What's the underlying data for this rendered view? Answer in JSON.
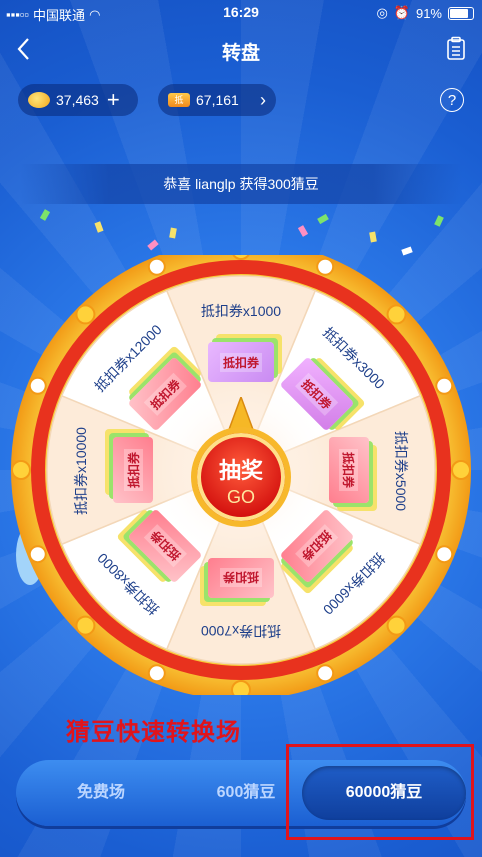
{
  "status_bar": {
    "carrier": "中国联通",
    "time": "16:29",
    "battery": "91%"
  },
  "nav": {
    "title": "转盘"
  },
  "wallet": {
    "beans": "37,463",
    "coupons": "67,161",
    "coupon_badge": "抵"
  },
  "marquee": {
    "text": "恭喜 lianglp 获得300猜豆"
  },
  "wheel": {
    "segments": [
      {
        "label": "抵扣券x1000",
        "coupon_text": "抵扣券"
      },
      {
        "label": "抵扣券x3000",
        "coupon_text": "抵扣券"
      },
      {
        "label": "抵扣券x5000",
        "coupon_text": "抵扣券"
      },
      {
        "label": "抵扣券x6000",
        "coupon_text": "抵扣券"
      },
      {
        "label": "抵扣券x7000",
        "coupon_text": "抵扣券"
      },
      {
        "label": "抵扣券x8000",
        "coupon_text": "抵扣券"
      },
      {
        "label": "抵扣券x10000",
        "coupon_text": "抵扣券"
      },
      {
        "label": "抵扣券x12000",
        "coupon_text": "抵扣券"
      }
    ],
    "center_main": "抽奖",
    "center_sub": "GO"
  },
  "caption": "猜豆快速转换场",
  "tabs": [
    {
      "label": "免费场"
    },
    {
      "label": "600猜豆"
    },
    {
      "label": "60000猜豆"
    }
  ],
  "colors": {
    "accent_red": "#e0141c",
    "wheel_rim": "#f7b82b",
    "background": "#2b78e8"
  }
}
